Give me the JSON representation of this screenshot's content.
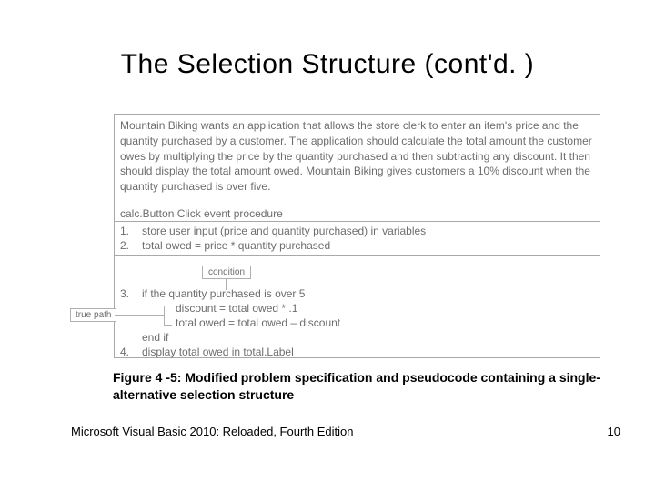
{
  "title": "The Selection Structure (cont'd. )",
  "spec": "Mountain Biking wants an application that allows the store clerk to enter an item's price and the quantity purchased by a customer. The application should calculate the total amount the customer owes by multiplying the price by the quantity purchased and then subtracting any discount. It then should display the total amount owed. Mountain Biking gives customers a 10% discount when the quantity purchased is over five.",
  "proc_title": "calc.Button Click event procedure",
  "steps": {
    "s1_num": "1.",
    "s1": "store user input (price and quantity purchased) in variables",
    "s2_num": "2.",
    "s2": "total owed = price * quantity purchased",
    "s3_num": "3.",
    "s3": "if the quantity purchased is over 5",
    "s3b": "discount = total owed * .1",
    "s3c": "total owed = total owed – discount",
    "endif": "end if",
    "s4_num": "4.",
    "s4": "display total owed in total.Label"
  },
  "labels": {
    "condition": "condition",
    "true_path": "true path"
  },
  "caption": "Figure 4 -5: Modified problem specification and pseudocode containing a single-alternative selection structure",
  "footer_left": "Microsoft Visual Basic 2010: Reloaded, Fourth Edition",
  "footer_right": "10"
}
